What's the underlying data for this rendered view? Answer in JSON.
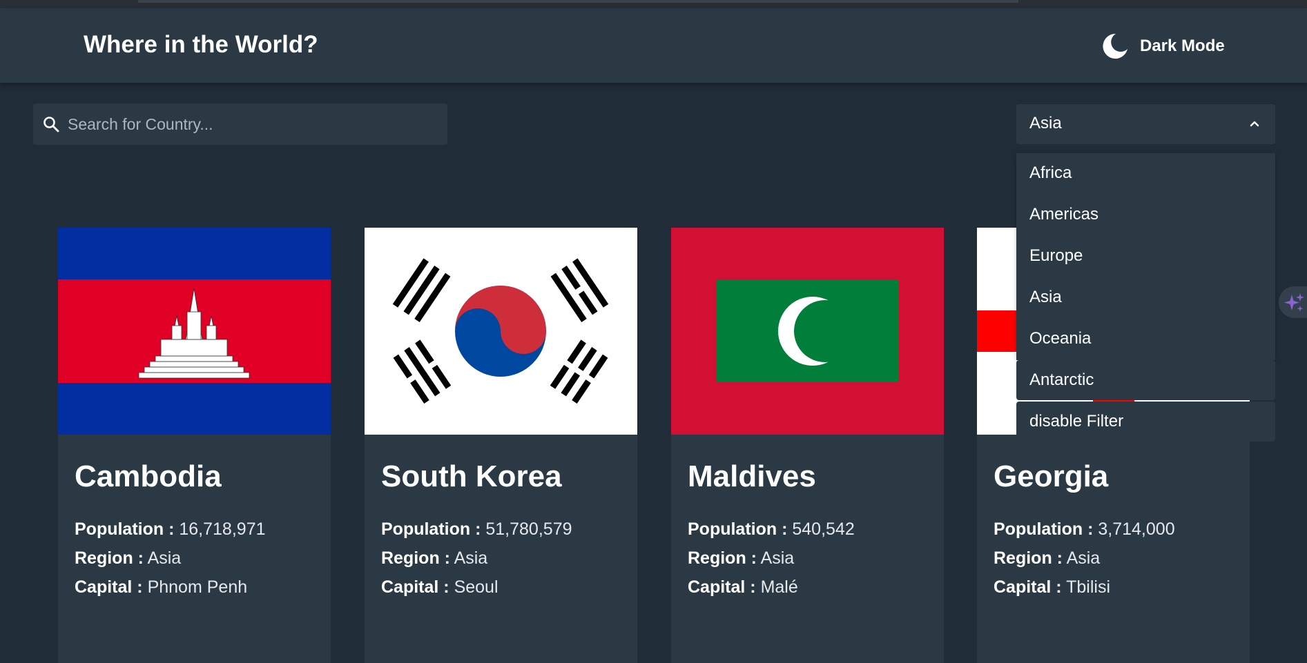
{
  "app": {
    "title": "Where in the World?",
    "mode_label": "Dark Mode"
  },
  "search": {
    "placeholder": "Search for Country...",
    "value": ""
  },
  "region_filter": {
    "selected": "Asia",
    "expanded": true,
    "options": [
      "Africa",
      "Americas",
      "Europe",
      "Asia",
      "Oceania",
      "Antarctic",
      "disable Filter"
    ]
  },
  "labels": {
    "population": "Population :",
    "region": "Region :",
    "capital": "Capital :"
  },
  "countries": [
    {
      "name": "Cambodia",
      "population": "16,718,971",
      "region": "Asia",
      "capital": "Phnom Penh"
    },
    {
      "name": "South Korea",
      "population": "51,780,579",
      "region": "Asia",
      "capital": "Seoul"
    },
    {
      "name": "Maldives",
      "population": "540,542",
      "region": "Asia",
      "capital": "Malé"
    },
    {
      "name": "Georgia",
      "population": "3,714,000",
      "region": "Asia",
      "capital": "Tbilisi"
    }
  ],
  "colors": {
    "background": "#202c37",
    "element": "#2b3945",
    "text": "#ffffff",
    "accent_sparkle": "#8a63d2"
  },
  "icons": {
    "mode": "moon-icon",
    "search": "search-icon",
    "select": "chevron-up-icon",
    "side": "sparkle-icon"
  }
}
